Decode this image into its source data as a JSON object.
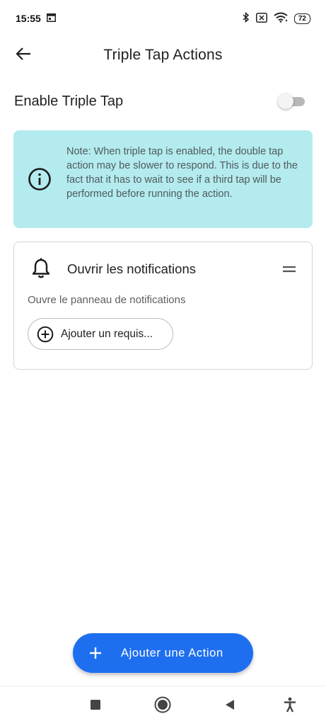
{
  "status_bar": {
    "time": "15:55",
    "battery": "72",
    "icons": [
      "calendar-icon",
      "bluetooth-icon",
      "sim-off-icon",
      "wifi-icon",
      "battery-icon"
    ]
  },
  "app_bar": {
    "title": "Triple Tap Actions",
    "back_icon": "arrow-back-icon"
  },
  "settings": {
    "enable_label": "Enable Triple Tap",
    "enabled": false
  },
  "note": {
    "icon": "info-icon",
    "text": "Note: When triple tap is enabled, the double tap action may be slower to respond. This is due to the fact that it has to wait to see if a third tap will be performed before running the action."
  },
  "actions": [
    {
      "icon": "bell-icon",
      "title": "Ouvrir les notifications",
      "description": "Ouvre le panneau de notifications",
      "add_requirement_label": "Ajouter un requis..."
    }
  ],
  "fab": {
    "label": "Ajouter une Action",
    "icon": "plus-icon"
  },
  "colors": {
    "note_background": "#b3ebee",
    "fab_background": "#1e6ff0"
  },
  "nav_bar": {
    "icons": [
      "recents-square-icon",
      "home-circle-icon",
      "back-triangle-icon",
      "accessibility-icon"
    ]
  }
}
